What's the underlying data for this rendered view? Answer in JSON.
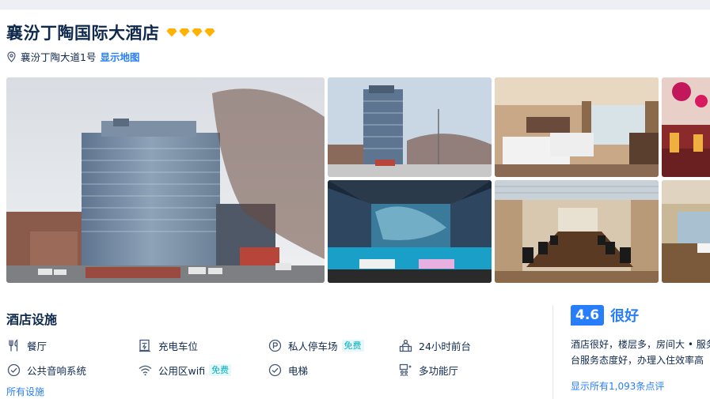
{
  "hotel": {
    "name": "襄汾丁陶国际大酒店",
    "star_count": 4,
    "star_color": "#ffb200",
    "address": "襄汾丁陶大道1号",
    "map_link": "显示地图"
  },
  "gallery": {
    "photo_count": 7,
    "photos": [
      "hotel-exterior-main",
      "hotel-exterior-wide",
      "guest-room-twin",
      "banquet-hall",
      "ktv-room",
      "meeting-room",
      "restaurant-hall"
    ]
  },
  "facilities": {
    "title": "酒店设施",
    "items": [
      {
        "icon": "utensils-icon",
        "label": "餐厅",
        "tag": ""
      },
      {
        "icon": "ev-charging-icon",
        "label": "充电车位",
        "tag": ""
      },
      {
        "icon": "parking-icon",
        "label": "私人停车场",
        "tag": "免费"
      },
      {
        "icon": "front-desk-icon",
        "label": "24小时前台",
        "tag": ""
      },
      {
        "icon": "check-circle-icon",
        "label": "公共音响系统",
        "tag": ""
      },
      {
        "icon": "wifi-icon",
        "label": "公用区wifi",
        "tag": "免费"
      },
      {
        "icon": "check-circle-icon",
        "label": "电梯",
        "tag": ""
      },
      {
        "icon": "multi-function-hall-icon",
        "label": "多功能厅",
        "tag": ""
      }
    ],
    "all_link": "所有设施"
  },
  "review": {
    "score": "4.6",
    "label": "很好",
    "text": "酒店很好，楼层多，房间大 • 服务台服务态度好，办理入住效率高",
    "all_link": "显示所有1,093条点评"
  },
  "colors": {
    "brand_blue": "#287dfa",
    "text_dark": "#0f294d",
    "free_tag": "#06aebd"
  }
}
